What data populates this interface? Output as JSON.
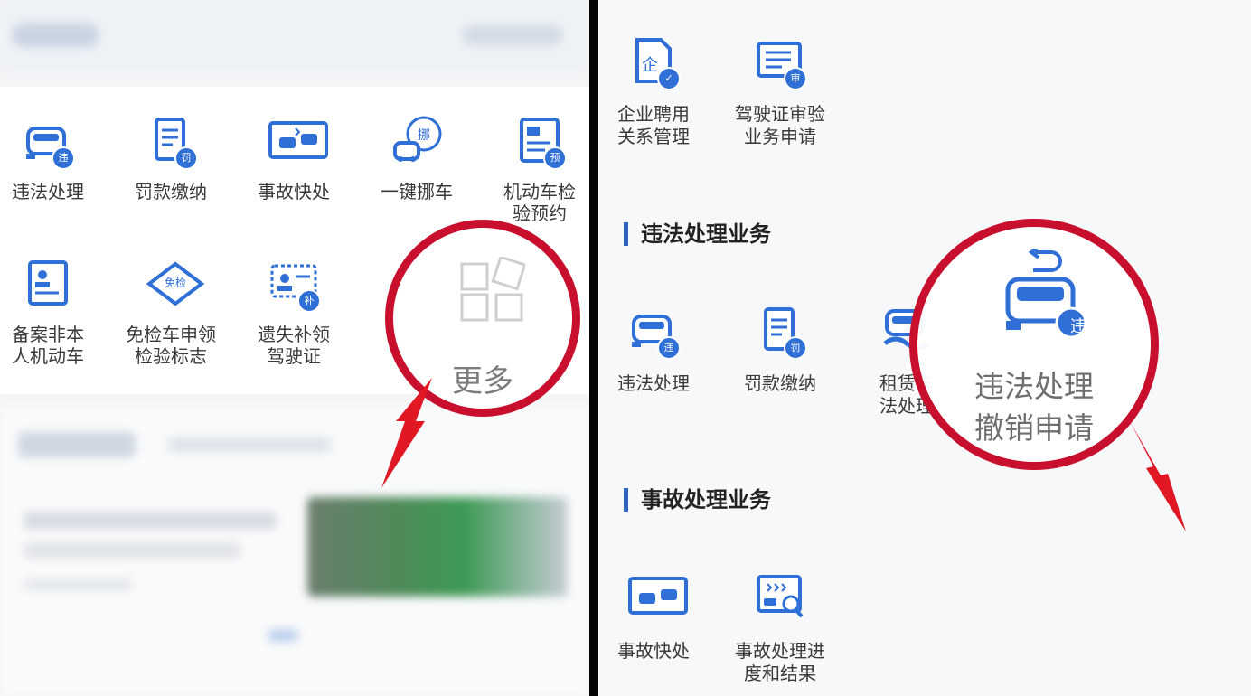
{
  "left": {
    "tiles": [
      {
        "label": "违法处理",
        "badge": "违"
      },
      {
        "label": "罚款缴纳",
        "badge": "罚"
      },
      {
        "label": "事故快处",
        "badge": ""
      },
      {
        "label": "一键挪车",
        "badge": "挪"
      },
      {
        "label": "机动车检\n验预约",
        "badge": "预"
      },
      {
        "label": "备案非本\n人机动车",
        "badge": ""
      },
      {
        "label": "免检车申领\n检验标志",
        "badge": "免检"
      },
      {
        "label": "遗失补领\n驾驶证",
        "badge": "补"
      }
    ],
    "more": {
      "label": "更多"
    }
  },
  "right": {
    "top_tiles": [
      {
        "label": "企业聘用\n关系管理",
        "badge": "企"
      },
      {
        "label": "驾驶证审验\n业务申请",
        "badge": "审"
      }
    ],
    "sections": [
      {
        "title": "违法处理业务",
        "tiles": [
          {
            "label": "违法处理",
            "badge": "违"
          },
          {
            "label": "罚款缴纳",
            "badge": "罚"
          },
          {
            "label": "租赁车\n法处理",
            "badge": ""
          }
        ]
      },
      {
        "title": "事故处理业务",
        "tiles": [
          {
            "label": "事故快处",
            "badge": ""
          },
          {
            "label": "事故处理进\n度和结果",
            "badge": ""
          }
        ]
      }
    ],
    "highlight": {
      "label": "违法处理\n撤销申请",
      "badge": "违"
    }
  },
  "colors": {
    "accent": "#2f6fd6",
    "highlight": "#c8102e",
    "divider": "#050505"
  },
  "icons": [
    "car-icon",
    "document-icon",
    "accident-photo-icon",
    "move-car-icon",
    "inspection-appointment-icon",
    "vehicle-record-icon",
    "exempt-tag-icon",
    "license-card-icon",
    "more-grid-icon",
    "enterprise-doc-icon",
    "license-review-icon",
    "rental-car-icon",
    "accident-progress-icon",
    "car-undo-icon"
  ]
}
